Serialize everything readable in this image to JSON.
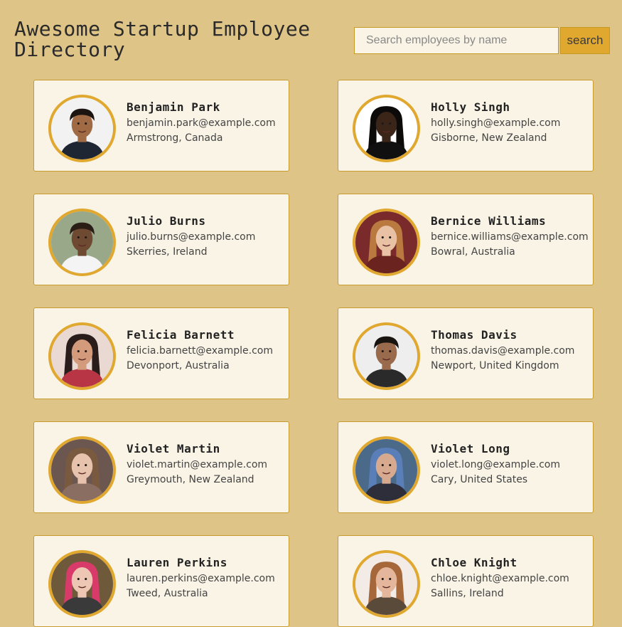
{
  "header": {
    "title": "Awesome Startup Employee Directory",
    "search_placeholder": "Search employees by name",
    "search_value": "",
    "search_button_label": "search"
  },
  "colors": {
    "page_background": "#dfc487",
    "card_background": "#faf4e6",
    "accent": "#e1a82f",
    "border": "#c79b2e"
  },
  "employees": [
    {
      "name": "Benjamin Park",
      "email": "benjamin.park@example.com",
      "location": "Armstrong, Canada",
      "avatar": "portrait-photo"
    },
    {
      "name": "Holly Singh",
      "email": "holly.singh@example.com",
      "location": "Gisborne, New Zealand",
      "avatar": "portrait-photo"
    },
    {
      "name": "Julio Burns",
      "email": "julio.burns@example.com",
      "location": "Skerries, Ireland",
      "avatar": "portrait-photo"
    },
    {
      "name": "Bernice Williams",
      "email": "bernice.williams@example.com",
      "location": "Bowral, Australia",
      "avatar": "portrait-photo"
    },
    {
      "name": "Felicia Barnett",
      "email": "felicia.barnett@example.com",
      "location": "Devonport, Australia",
      "avatar": "portrait-photo"
    },
    {
      "name": "Thomas Davis",
      "email": "thomas.davis@example.com",
      "location": "Newport, United Kingdom",
      "avatar": "portrait-photo"
    },
    {
      "name": "Violet Martin",
      "email": "violet.martin@example.com",
      "location": "Greymouth, New Zealand",
      "avatar": "portrait-photo"
    },
    {
      "name": "Violet Long",
      "email": "violet.long@example.com",
      "location": "Cary, United States",
      "avatar": "portrait-photo"
    },
    {
      "name": "Lauren Perkins",
      "email": "lauren.perkins@example.com",
      "location": "Tweed, Australia",
      "avatar": "portrait-photo"
    },
    {
      "name": "Chloe Knight",
      "email": "chloe.knight@example.com",
      "location": "Sallins, Ireland",
      "avatar": "portrait-photo"
    }
  ]
}
